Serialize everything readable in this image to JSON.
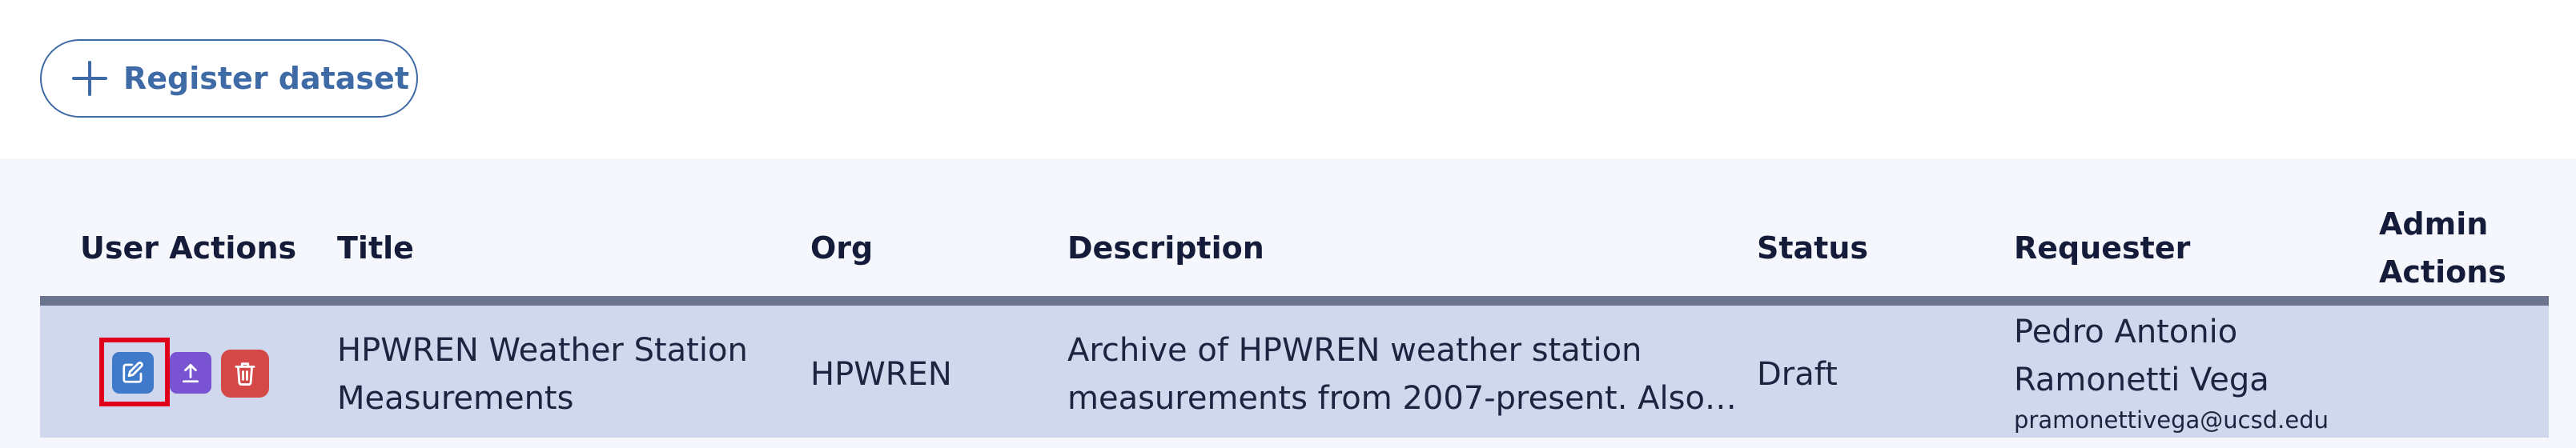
{
  "toolbar": {
    "register_label": "Register dataset"
  },
  "table": {
    "headers": {
      "user_actions": "User Actions",
      "title": "Title",
      "org": "Org",
      "description": "Description",
      "status": "Status",
      "requester": "Requester",
      "admin_actions_line1": "Admin",
      "admin_actions_line2": "Actions"
    },
    "rows": [
      {
        "title_line1": "HPWREN Weather Station",
        "title_line2": "Measurements",
        "org": "HPWREN",
        "description_line1": "Archive of HPWREN weather station",
        "description_line2": "measurements from 2007-present. Also…",
        "status": "Draft",
        "requester_line1": "Pedro Antonio",
        "requester_line2": "Ramonetti Vega",
        "requester_email": "pramonettivega@ucsd.edu"
      }
    ]
  },
  "icons": {
    "edit": "edit-icon",
    "upload": "upload-icon",
    "delete": "trash-icon",
    "add": "plus-icon"
  },
  "colors": {
    "accent": "#3e6aa5",
    "edit": "#3f79c9",
    "upload": "#7a53d3",
    "delete": "#d44848",
    "row_bg": "#cfd8ec",
    "highlight": "#e0001b"
  }
}
